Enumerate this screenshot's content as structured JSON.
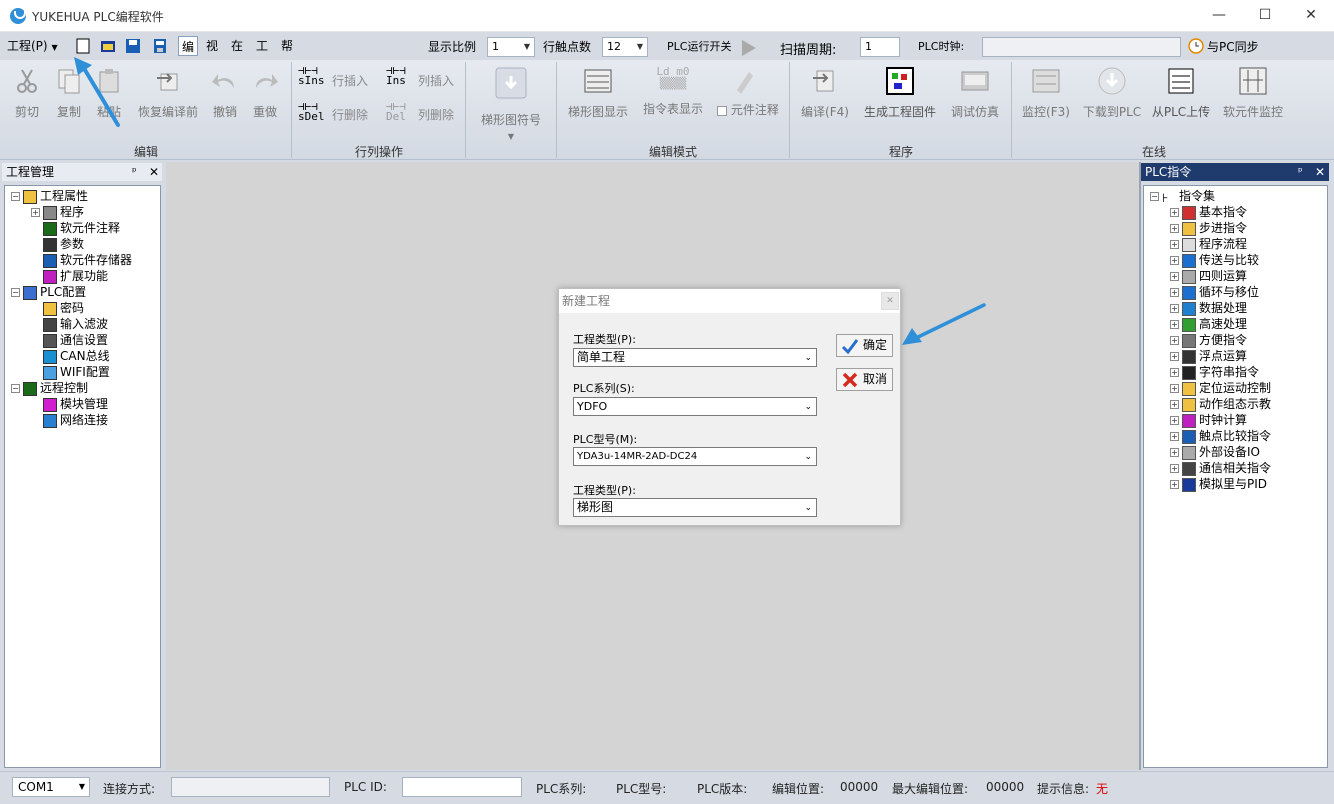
{
  "window": {
    "title": "YUKEHUA PLC编程软件"
  },
  "menubar": {
    "project": "工程(P)",
    "tabs": [
      "编",
      "视",
      "在",
      "工",
      "帮"
    ],
    "display_ratio_label": "显示比例",
    "display_ratio_value": "1",
    "row_contacts_label": "行触点数",
    "row_contacts_value": "12",
    "plc_run_switch": "PLC运行开关",
    "scan_cycle_label": "扫描周期:",
    "scan_cycle_value": "1",
    "plc_clock_label": "PLC时钟:",
    "plc_clock_value": "",
    "pc_sync": "与PC同步"
  },
  "ribbon": {
    "edit": {
      "cut": "剪切",
      "copy": "复制",
      "paste": "粘贴",
      "restore": "恢复编译前",
      "undo": "撤销",
      "redo": "重做",
      "group": "编辑"
    },
    "rowcol": {
      "sins": "sIns",
      "row_insert": "行插入",
      "ins": "Ins",
      "col_insert": "列插入",
      "sdel": "sDel",
      "row_delete": "行删除",
      "del": "Del",
      "col_delete": "列删除",
      "group": "行列操作"
    },
    "ladder_symbol": "梯形图符号",
    "mode": {
      "ladder_display": "梯形图显示",
      "instr_display": "指令表显示",
      "ldm0": "Ld m0",
      "comment": "元件注释",
      "group": "编辑模式"
    },
    "program": {
      "compile": "编译(F4)",
      "gen_firmware": "生成工程固件",
      "debug_sim": "调试仿真",
      "group": "程序"
    },
    "online": {
      "monitor": "监控(F3)",
      "download": "下载到PLC",
      "upload": "从PLC上传",
      "soft_monitor": "软元件监控",
      "group": "在线"
    }
  },
  "left_panel": {
    "title": "工程管理",
    "items": [
      {
        "label": "工程属性",
        "level": 0,
        "exp": "−"
      },
      {
        "label": "程序",
        "level": 1,
        "exp": "+"
      },
      {
        "label": "软元件注释",
        "level": 1,
        "exp": ""
      },
      {
        "label": "参数",
        "level": 1,
        "exp": ""
      },
      {
        "label": "软元件存储器",
        "level": 1,
        "exp": ""
      },
      {
        "label": "扩展功能",
        "level": 1,
        "exp": ""
      },
      {
        "label": "PLC配置",
        "level": 0,
        "exp": "−"
      },
      {
        "label": "密码",
        "level": 1,
        "exp": ""
      },
      {
        "label": "输入滤波",
        "level": 1,
        "exp": ""
      },
      {
        "label": "通信设置",
        "level": 1,
        "exp": ""
      },
      {
        "label": "CAN总线",
        "level": 1,
        "exp": ""
      },
      {
        "label": "WIFI配置",
        "level": 1,
        "exp": ""
      },
      {
        "label": "远程控制",
        "level": 0,
        "exp": "−"
      },
      {
        "label": "模块管理",
        "level": 1,
        "exp": ""
      },
      {
        "label": "网络连接",
        "level": 1,
        "exp": ""
      }
    ]
  },
  "right_panel": {
    "title": "PLC指令",
    "root": "指令集",
    "items": [
      "基本指令",
      "步进指令",
      "程序流程",
      "传送与比较",
      "四则运算",
      "循环与移位",
      "数据处理",
      "高速处理",
      "方便指令",
      "浮点运算",
      "字符串指令",
      "定位运动控制",
      "动作组态示教",
      "时钟计算",
      "触点比较指令",
      "外部设备IO",
      "通信相关指令",
      "模拟里与PID"
    ]
  },
  "dialog": {
    "title": "新建工程",
    "project_type_label": "工程类型(P):",
    "project_type_value": "简单工程",
    "plc_series_label": "PLC系列(S):",
    "plc_series_value": "YDFO",
    "plc_model_label": "PLC型号(M):",
    "plc_model_value": "YDA3u-14MR-2AD-DC24",
    "program_type_label": "工程类型(P):",
    "program_type_value": "梯形图",
    "ok": "确定",
    "cancel": "取消"
  },
  "statusbar": {
    "port": "COM1",
    "conn_label": "连接方式:",
    "plc_id_label": "PLC ID:",
    "series_label": "PLC系列:",
    "model_label": "PLC型号:",
    "version_label": "PLC版本:",
    "edit_pos_label": "编辑位置:",
    "edit_pos_value": "00000",
    "max_edit_label": "最大编辑位置:",
    "max_edit_value": "00000",
    "hint_label": "提示信息:",
    "hint_value": "无"
  },
  "colors": {
    "accent_arrow": "#2f8fd8",
    "hint_red": "#e00000"
  }
}
